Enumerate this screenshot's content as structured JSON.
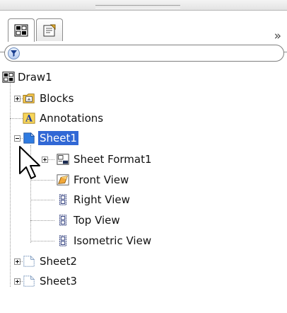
{
  "toolbar": {
    "tabs": [
      {
        "name": "featuremanager-tree-icon"
      },
      {
        "name": "property-manager-icon"
      }
    ],
    "overflow_label": "»"
  },
  "filter": {
    "placeholder": "",
    "value": ""
  },
  "tree": {
    "root": {
      "label": "Draw1",
      "icon": "drawing-icon"
    },
    "blocks": {
      "label": "Blocks",
      "icon": "blocks-folder-icon"
    },
    "annotations": {
      "label": "Annotations",
      "icon": "annotations-icon"
    },
    "sheet1": {
      "label": "Sheet1",
      "icon": "sheet-icon",
      "selected": true
    },
    "sheet_format": {
      "label": "Sheet Format1",
      "icon": "sheet-format-icon"
    },
    "front_view": {
      "label": "Front View",
      "icon": "front-view-icon"
    },
    "right_view": {
      "label": "Right View",
      "icon": "projected-view-icon"
    },
    "top_view": {
      "label": "Top View",
      "icon": "projected-view-icon"
    },
    "iso_view": {
      "label": "Isometric View",
      "icon": "projected-view-icon"
    },
    "sheet2": {
      "label": "Sheet2",
      "icon": "sheet-icon"
    },
    "sheet3": {
      "label": "Sheet3",
      "icon": "sheet-icon"
    }
  },
  "colors": {
    "selection": "#3168d5",
    "sheet_icon": "#2f7be0"
  }
}
